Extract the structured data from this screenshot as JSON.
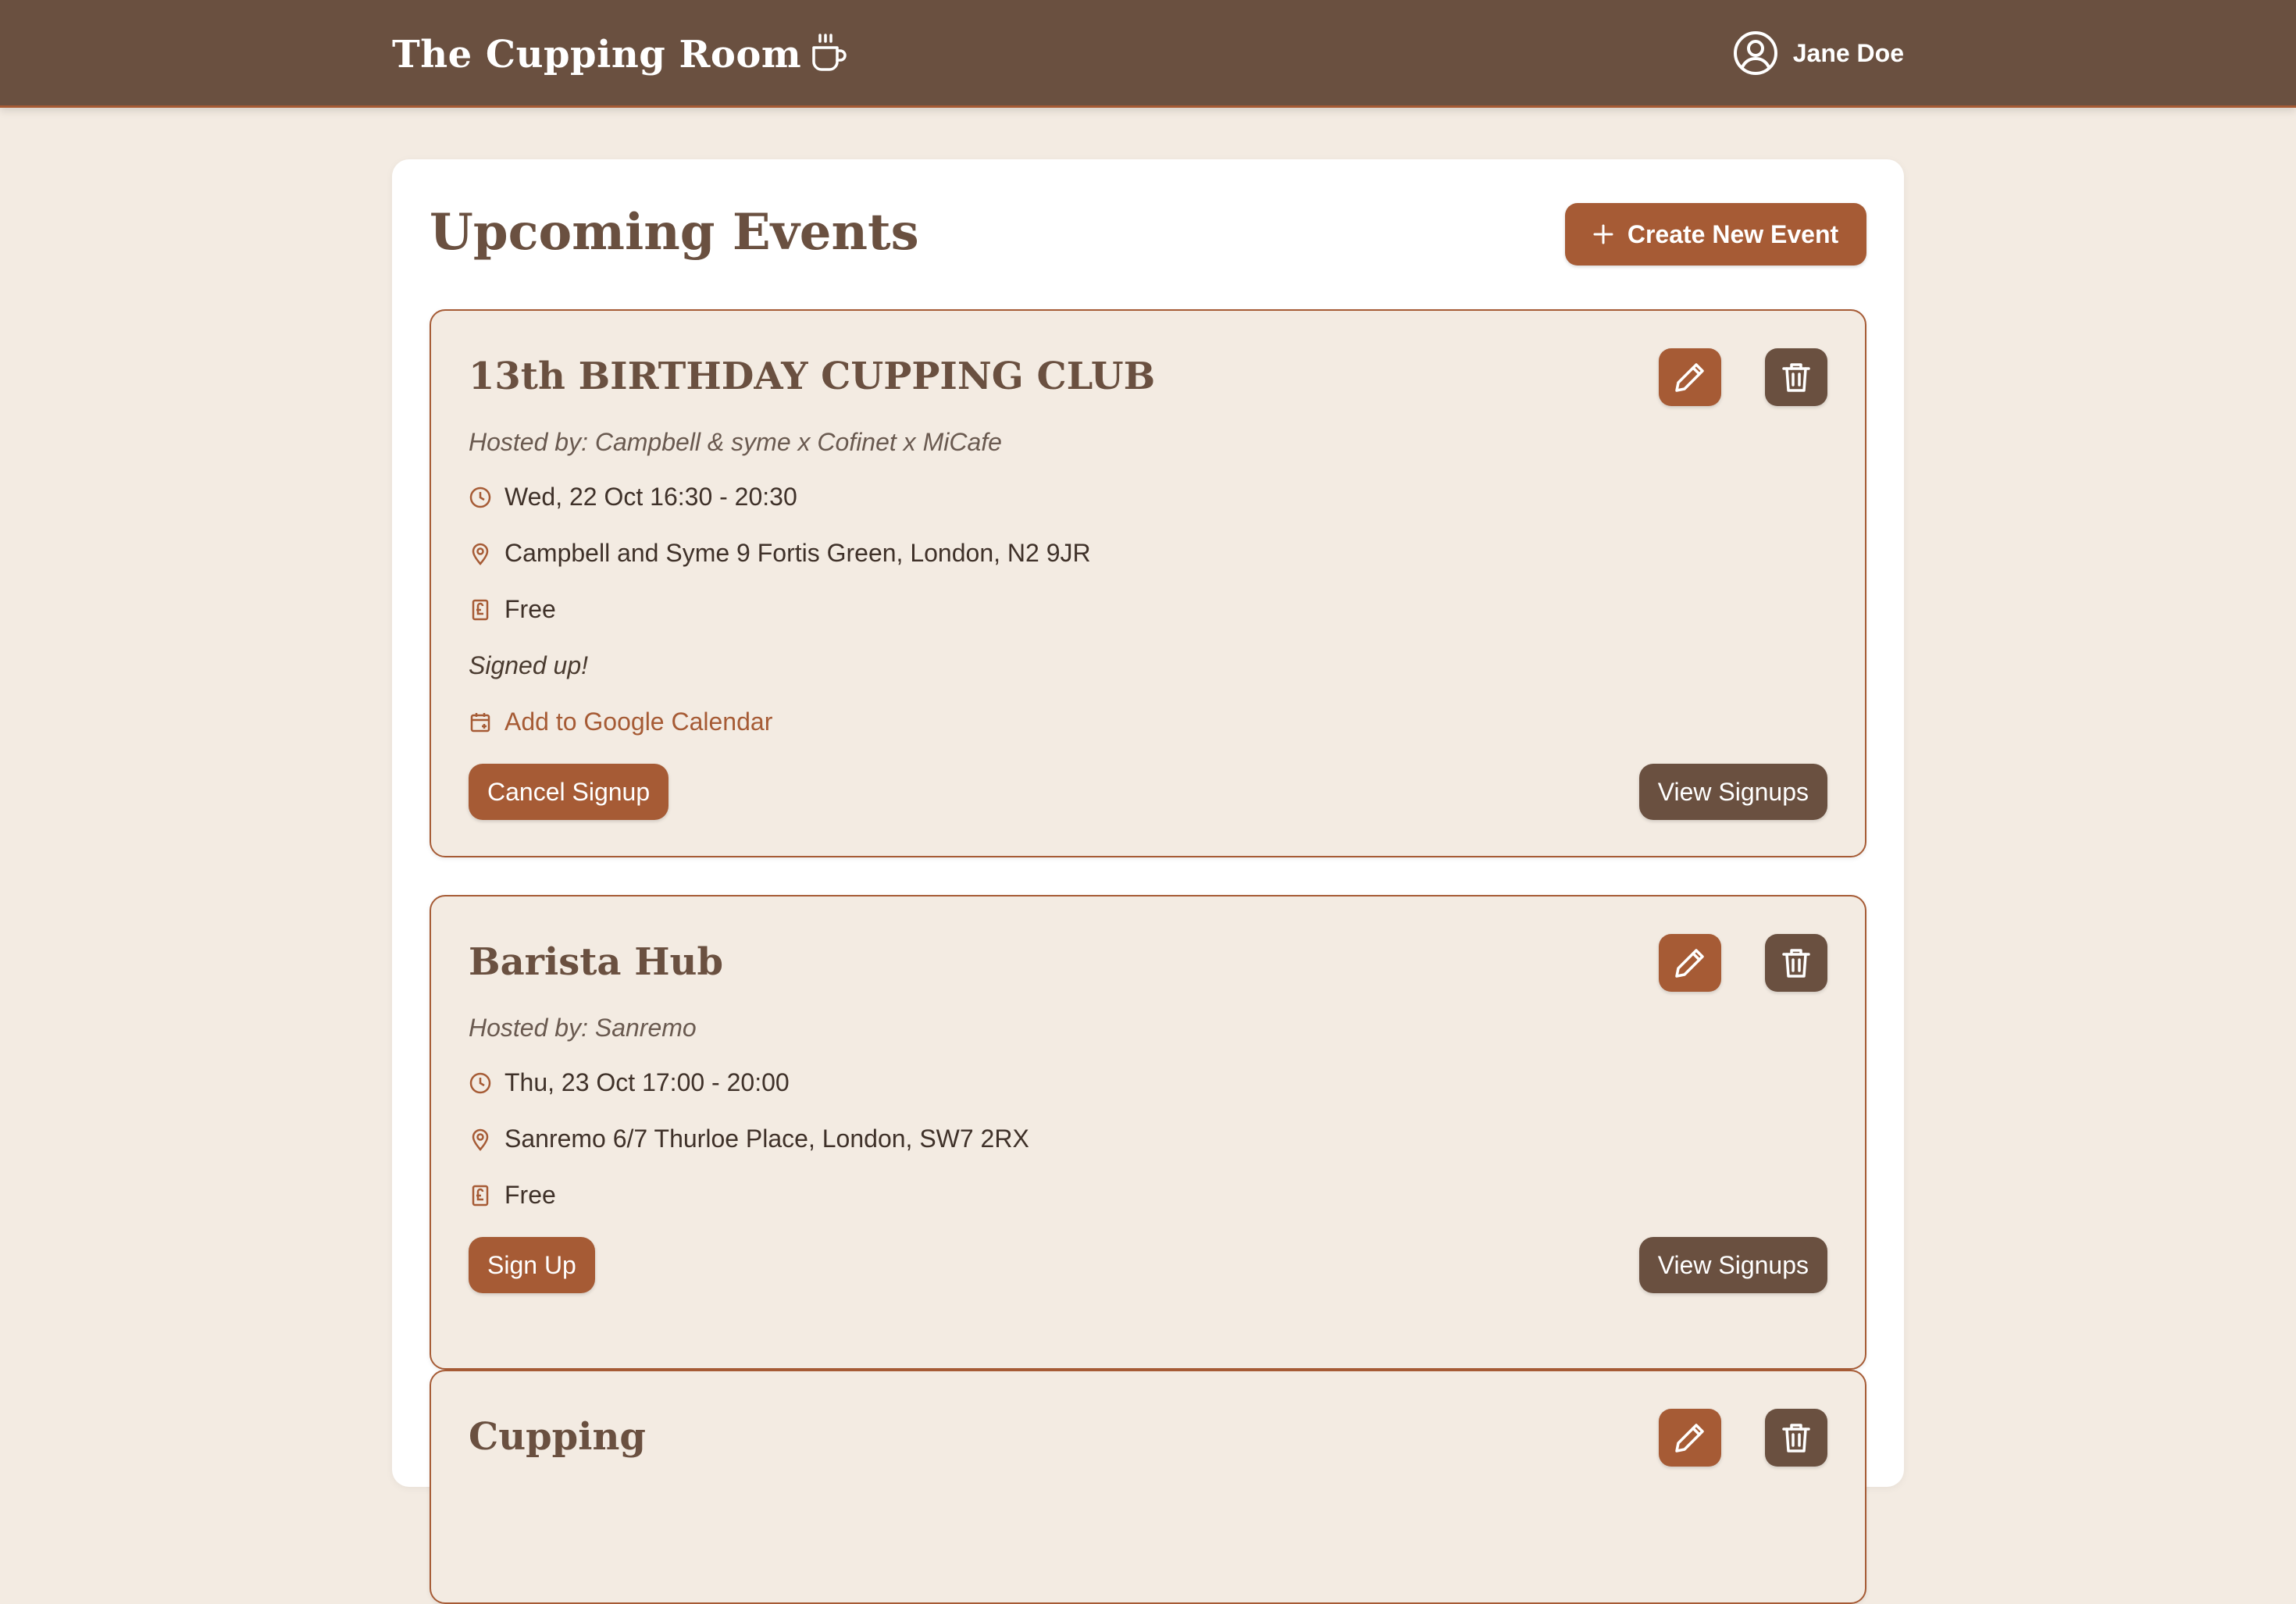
{
  "header": {
    "brand": "The Cupping Room",
    "brand_icon": "coffee-cup-icon",
    "user_name": "Jane Doe",
    "user_icon": "user-circle-icon"
  },
  "colors": {
    "header_bg": "#6a5040",
    "accent": "#a65b35",
    "page_bg": "#f3ebe2",
    "card_bg": "#f3ebe2"
  },
  "main": {
    "title": "Upcoming Events",
    "create_button": "Create New Event",
    "events": [
      {
        "title": "13th BIRTHDAY CUPPING CLUB",
        "hosted_by": "Hosted by: Campbell & syme x Cofinet x MiCafe",
        "datetime": "Wed, 22 Oct 16:30 - 20:30",
        "location": "Campbell and Syme 9 Fortis Green, London, N2 9JR",
        "price": "Free",
        "status": "Signed up!",
        "calendar_link": "Add to Google Calendar",
        "primary_action": "Cancel Signup",
        "secondary_action": "View Signups"
      },
      {
        "title": "Barista Hub",
        "hosted_by": "Hosted by: Sanremo",
        "datetime": "Thu, 23 Oct 17:00 - 20:00",
        "location": "Sanremo 6/7 Thurloe Place, London, SW7 2RX",
        "price": "Free",
        "primary_action": "Sign Up",
        "secondary_action": "View Signups"
      },
      {
        "title": "Cupping"
      }
    ]
  }
}
